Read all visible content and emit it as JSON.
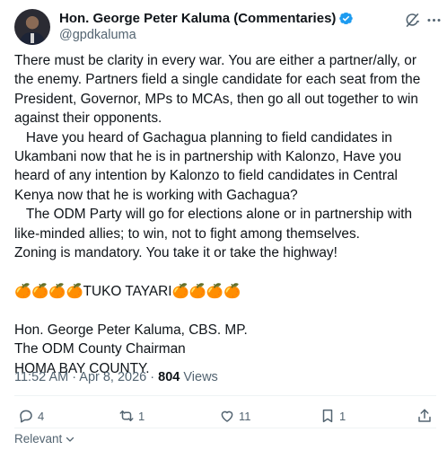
{
  "author": {
    "name": "Hon. George Peter Kaluma (Commentaries)",
    "handle": "@gpdkaluma",
    "verified_color": "#1d9bf0"
  },
  "tweet": {
    "text": "There must be clarity in every war. You are either a partner/ally, or the enemy. Partners field a single candidate for each seat from the President, Governor, MPs to MCAs, then go all out together to win against their opponents.\n   Have you heard of Gachagua planning to field candidates in Ukambani now that he is in partnership with Kalonzo, Have you heard of any intention by Kalonzo to field candidates in Central Kenya now that he is working with Gachagua?\n   The ODM Party will go for elections alone or in partnership with like-minded allies; to win, not to fight among themselves.\nZoning is mandatory. You take it or take the highway!\n\n🍊🍊🍊🍊TUKO TAYARI🍊🍊🍊🍊\n\nHon. George Peter Kaluma, CBS. MP.\nThe ODM County Chairman\nHOMA BAY COUNTY.",
    "time": "11:52 AM · Apr 8, 2026 · ",
    "views_count": "804",
    "views_label": " Views"
  },
  "actions": {
    "replies": "4",
    "reposts": "1",
    "likes": "11",
    "bookmarks": "1"
  },
  "icons": {
    "header": [
      "grok-icon",
      "more-icon"
    ],
    "actions": [
      "reply-icon",
      "repost-icon",
      "like-icon",
      "bookmark-icon",
      "share-icon"
    ]
  },
  "footer": {
    "sort_label": "Relevant"
  }
}
